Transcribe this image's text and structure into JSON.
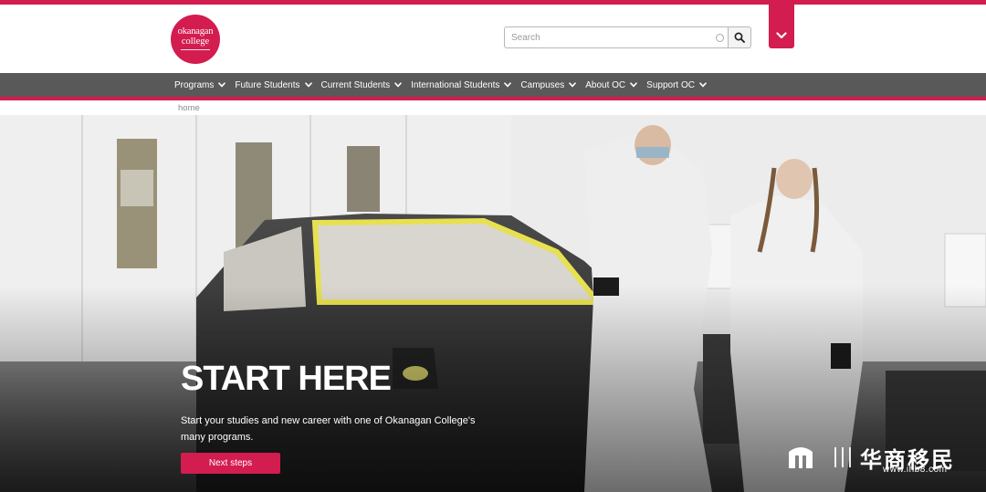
{
  "brand": {
    "logo_line1": "okanagan",
    "logo_line2": "college",
    "accent": "#d31c4f"
  },
  "search": {
    "placeholder": "Search",
    "value": "",
    "button_icon": "search-icon"
  },
  "menu_toggle": {
    "icon": "chevron-down-icon"
  },
  "nav": {
    "items": [
      {
        "label": "Programs"
      },
      {
        "label": "Future Students"
      },
      {
        "label": "Current Students"
      },
      {
        "label": "International Students"
      },
      {
        "label": "Campuses"
      },
      {
        "label": "About OC"
      },
      {
        "label": "Support OC"
      }
    ],
    "background": "#595959"
  },
  "breadcrumb": {
    "home": "home"
  },
  "hero": {
    "title": "START HERE",
    "text": "Start your studies and new career with one of Okanagan College's many programs.",
    "button_label": "Next steps"
  },
  "watermark": {
    "chinese": "华商移民",
    "url": "www.ihb8.com"
  }
}
